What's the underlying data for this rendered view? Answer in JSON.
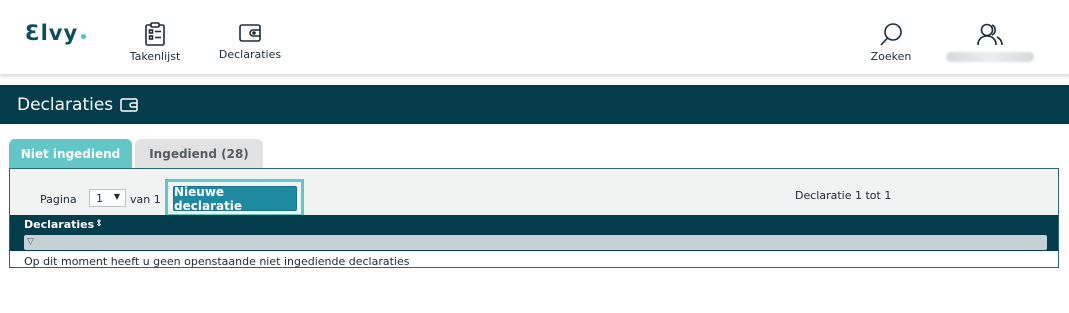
{
  "app": {
    "logo_text": "Ɛlvy"
  },
  "nav": {
    "takenlijst": "Takenlijst",
    "declaraties": "Declaraties",
    "zoeken": "Zoeken"
  },
  "page": {
    "title": "Declaraties"
  },
  "tabs": [
    {
      "label": "Niet ingediend",
      "active": true
    },
    {
      "label": "Ingediend (28)",
      "active": false
    }
  ],
  "toolbar": {
    "pagina_label": "Pagina",
    "page_value": "1",
    "van_label": "van 1",
    "new_button": "Nieuwe declaratie",
    "range_label": "Declaratie 1 tot 1"
  },
  "table": {
    "column_header": "Declaraties",
    "empty_message": "Op dit moment heeft u geen openstaande niet ingediende declaraties"
  },
  "colors": {
    "brand_dark": "#033d4b",
    "accent": "#63c7c7",
    "button": "#1e8aa1"
  },
  "icons": {
    "takenlijst": "clipboard-list-icon",
    "declaraties": "wallet-icon",
    "zoeken": "search-icon",
    "user": "users-icon"
  }
}
